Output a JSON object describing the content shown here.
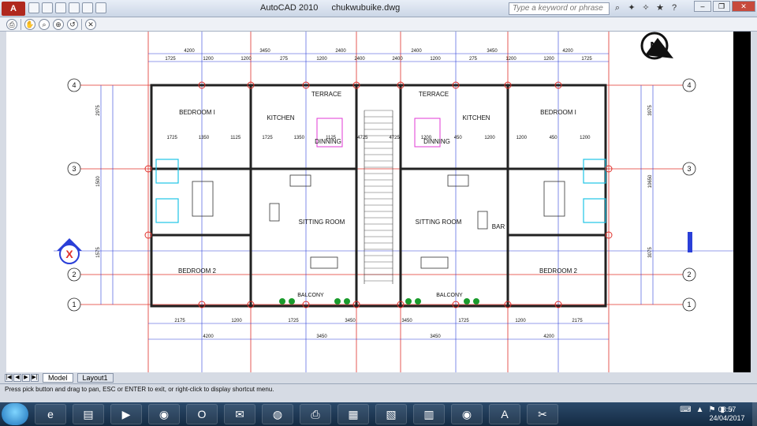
{
  "titlebar": {
    "app_logo": "A",
    "app_name": "AutoCAD 2010",
    "file_name": "chukwubuike.dwg",
    "search_placeholder": "Type a keyword or phrase",
    "minimize": "–",
    "restore": "❐",
    "close": "✕"
  },
  "toolbar": {
    "icons": [
      "print-icon",
      "pan-icon",
      "zoom-realtime-icon",
      "zoom-window-icon",
      "zoom-previous-icon",
      "close-icon"
    ]
  },
  "drawing": {
    "north": "N",
    "grid_numbers": [
      "4",
      "3",
      "2",
      "1"
    ],
    "section_marker": "X",
    "rooms_left": {
      "bedroom1": "BEDROOM I",
      "bedroom2": "BEDROOM 2",
      "kitchen": "KITCHEN",
      "terrace": "TERRACE",
      "dining": "DINNING",
      "sitting": "SITTING ROOM",
      "balcony": "BALCONY"
    },
    "rooms_right": {
      "bedroom1": "BEDROOM I",
      "bedroom2": "BEDROOM 2",
      "kitchen": "KITCHEN",
      "terrace": "TERRACE",
      "dining": "DINNING",
      "sitting": "SITTING ROOM",
      "balcony": "BALCONY",
      "bar": "BAR"
    },
    "dims_top": [
      "1725",
      "1200",
      "1200",
      "275",
      "1200",
      "2400",
      "2400",
      "1200",
      "275",
      "1200",
      "1200",
      "1725"
    ],
    "dims_top2": [
      "4200",
      "3450",
      "2400",
      "2400",
      "3450",
      "4200"
    ],
    "dims_bottom": [
      "2175",
      "1200",
      "1725",
      "3450",
      "3450",
      "1725",
      "1200",
      "2175"
    ],
    "dims_bottom2": [
      "4200",
      "3450",
      "3450",
      "4200"
    ],
    "dims_inner": [
      "1725",
      "1350",
      "1125",
      "1725",
      "1350",
      "1125",
      "4725",
      "4725",
      "1200",
      "450",
      "1200",
      "1200",
      "450",
      "1200"
    ],
    "dims_vertical": [
      "2975",
      "1500",
      "1575",
      "3975",
      "10650",
      "3075"
    ]
  },
  "layout_tabs": {
    "model": "Model",
    "layout1": "Layout1"
  },
  "command_line": "Press pick button and drag to pan, ESC or ENTER to exit, or right-click to display shortcut menu.",
  "taskbar": {
    "apps": [
      "internet-explorer-icon",
      "file-explorer-icon",
      "media-player-icon",
      "chrome-icon",
      "opera-icon",
      "outlook-icon",
      "firefox-icon",
      "scanner-icon",
      "notepad-icon",
      "sheets-icon",
      "calculator-icon",
      "chrome-icon",
      "autocad-icon",
      "tools-icon"
    ],
    "time": "08:57",
    "date": "24/04/2017"
  }
}
